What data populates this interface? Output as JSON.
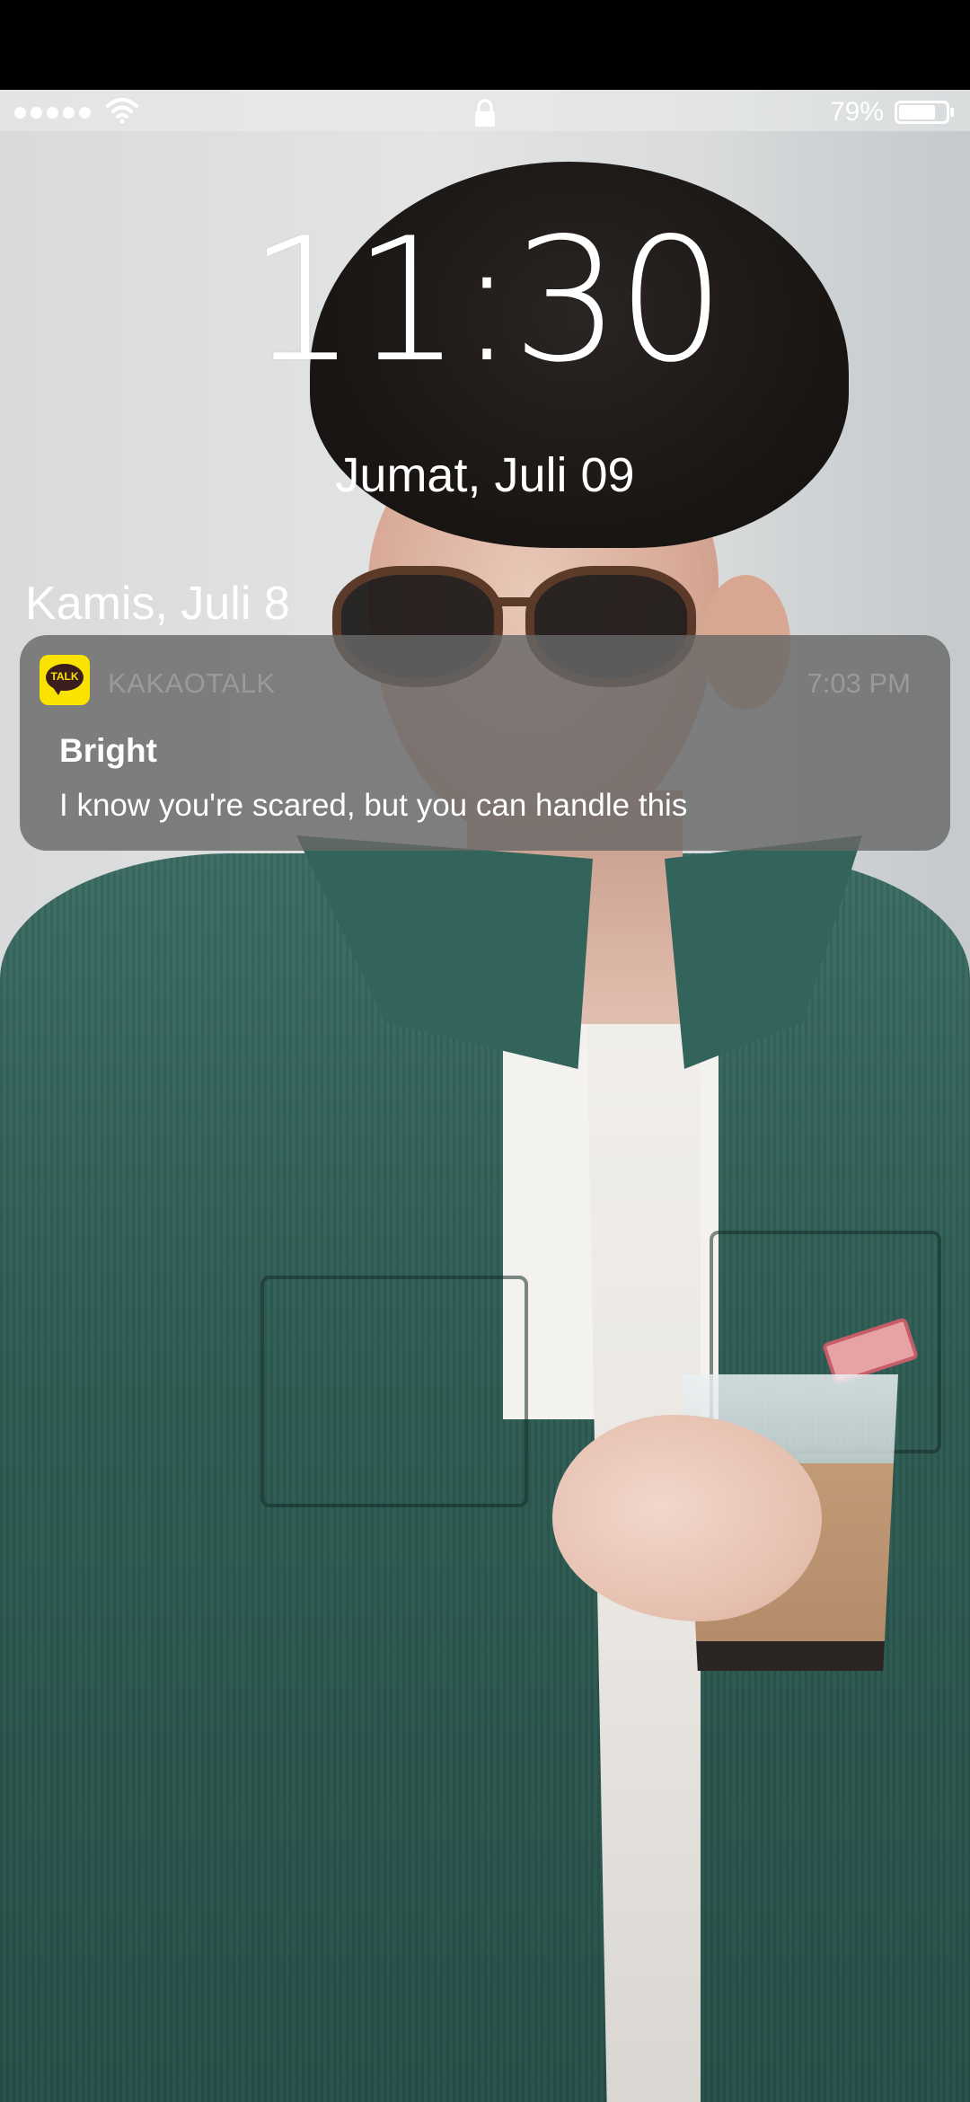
{
  "status_bar": {
    "signal_dots": 5,
    "wifi_icon": "wifi-icon",
    "lock_icon": "lock-icon",
    "battery_percent": "79%",
    "battery_level": 0.79
  },
  "lock_screen": {
    "time": "11:30",
    "date": "Jumat, Juli 09"
  },
  "notifications": {
    "group_header": "Kamis, Juli 8",
    "items": [
      {
        "app_name": "KAKAOTALK",
        "app_icon": "kakaotalk-icon",
        "app_icon_text": "TALK",
        "app_icon_color": "#fae300",
        "time": "7:03 PM",
        "sender": "Bright",
        "message": "I know you're scared, but you can handle this"
      }
    ]
  },
  "wallpaper": {
    "description_icon": "wallpaper-photo"
  }
}
